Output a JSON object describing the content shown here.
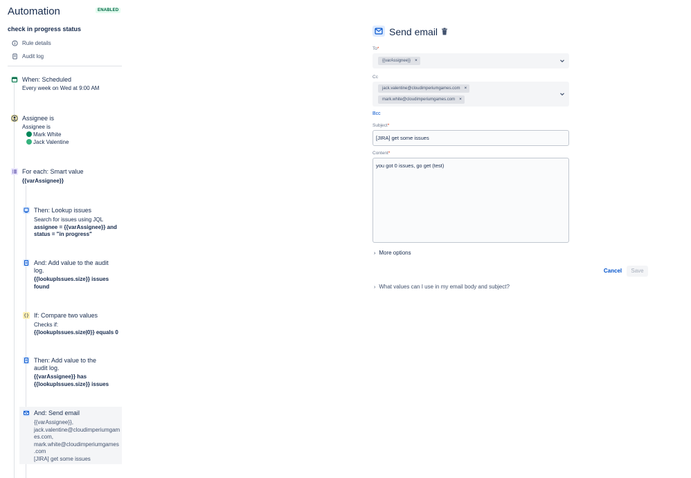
{
  "app": {
    "title": "Automation",
    "status_badge": "ENABLED"
  },
  "rule": {
    "name": "check in progress status"
  },
  "menu": [
    {
      "label": "Rule details",
      "icon": "info-icon"
    },
    {
      "label": "Audit log",
      "icon": "document-icon"
    }
  ],
  "steps": {
    "trigger": {
      "title": "When: Scheduled",
      "detail": "Every week on Wed at 9:00 AM"
    },
    "condition": {
      "title": "Assignee is",
      "detail": "Assignee is",
      "users": [
        {
          "name": "Mark White",
          "color": "#00875a"
        },
        {
          "name": "Jack Valentine",
          "color": "#36b37e"
        }
      ]
    },
    "branch": {
      "title": "For each: Smart value",
      "detail": "{{varAssignee}}"
    },
    "lookup": {
      "title": "Then: Lookup issues",
      "detail": "Search for issues using JQL",
      "jql_1": "assignee = {{varAssignee}} and",
      "jql_2": "status = \"in progress\""
    },
    "audit1": {
      "title_1": "And: Add value to the audit",
      "title_2": "log.",
      "detail_1": "{{lookupIssues.size}} issues",
      "detail_2": "found"
    },
    "compare": {
      "title": "If: Compare two values",
      "detail": "Checks if:",
      "expr": "{{lookupIssues.size|0}} equals 0"
    },
    "audit2": {
      "title_1": "Then: Add value to the",
      "title_2": "audit log.",
      "detail_1": "{{varAssignee}} has",
      "detail_2": "{{lookupIssues.size}} issues"
    },
    "email": {
      "title": "And: Send email",
      "line_1": "{{varAssignee}},",
      "line_2": "jack.valentine@cloudimperiumgam",
      "line_3": "es.com,",
      "line_4": "mark.white@cloudimperiumgames",
      "line_5": ".com",
      "line_6": "[JIRA] get some issues"
    }
  },
  "panel": {
    "title": "Send email",
    "to": {
      "label": "To",
      "chips": [
        "{{varAssignee}}"
      ]
    },
    "cc": {
      "label": "Cc",
      "chips": [
        "jack.valentine@cloudimperiumgames.com",
        "mark.white@cloudimperiumgames.com"
      ]
    },
    "bcc_label": "Bcc",
    "subject": {
      "label": "Subject",
      "value": "[JIRA] get some issues"
    },
    "content": {
      "label": "Content",
      "value": "you got 0 issues, go get (test)"
    },
    "more_options": "More options",
    "cancel": "Cancel",
    "save": "Save",
    "help": "What values can I use in my email body and subject?"
  },
  "colors": {
    "accent": "#0052cc",
    "badge_bg": "#e3fcef",
    "badge_fg": "#006644",
    "required": "#de350b"
  }
}
